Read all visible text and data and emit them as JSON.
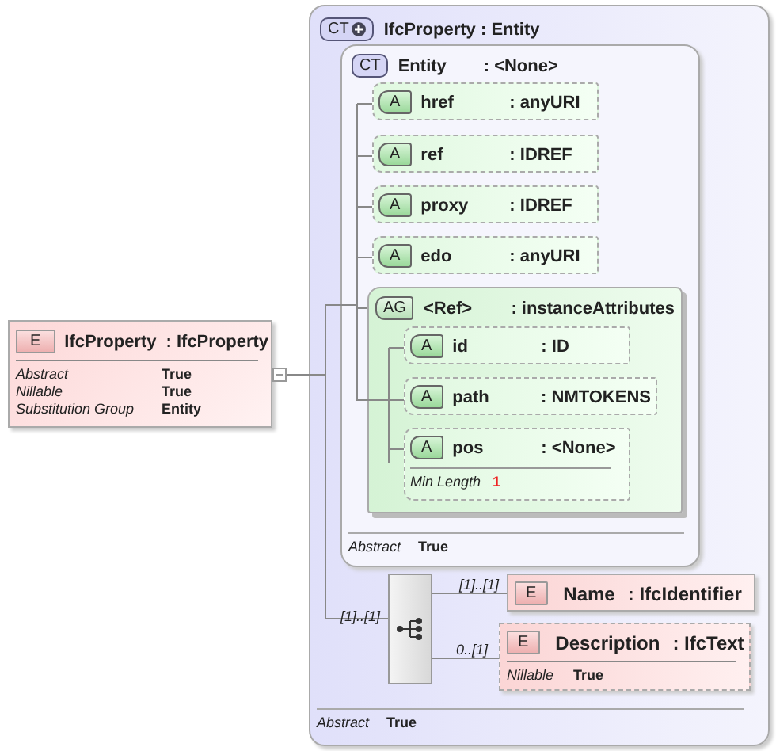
{
  "root_element": {
    "badge": "E",
    "name": "IfcProperty",
    "type": ": IfcProperty",
    "properties": [
      {
        "label": "Abstract",
        "value": "True"
      },
      {
        "label": "Nillable",
        "value": "True"
      },
      {
        "label": "Substitution Group",
        "value": "Entity"
      }
    ]
  },
  "complex_type": {
    "badge": "CT",
    "name": "IfcProperty : Entity",
    "base": {
      "badge": "CT",
      "name": "Entity",
      "type": ": <None>",
      "attributes": [
        {
          "badge": "A",
          "name": "href",
          "type": ": anyURI",
          "optional": true
        },
        {
          "badge": "A",
          "name": "ref",
          "type": ": IDREF",
          "optional": true
        },
        {
          "badge": "A",
          "name": "proxy",
          "type": ": IDREF",
          "optional": true
        },
        {
          "badge": "A",
          "name": "edo",
          "type": ": anyURI",
          "optional": true
        }
      ],
      "attribute_group": {
        "badge": "AG",
        "name": "<Ref>",
        "type": ": instanceAttributes",
        "attributes": [
          {
            "badge": "A",
            "name": "id",
            "type": ": ID",
            "optional": true
          },
          {
            "badge": "A",
            "name": "path",
            "type": ": NMTOKENS",
            "optional": true
          },
          {
            "badge": "A",
            "name": "pos",
            "type": ": <None>",
            "optional": true,
            "properties": [
              {
                "label": "Min Length",
                "value": "1"
              }
            ]
          }
        ]
      },
      "properties": [
        {
          "label": "Abstract",
          "value": "True"
        }
      ]
    },
    "sequence": {
      "occurrence": "[1]..[1]",
      "elements": [
        {
          "badge": "E",
          "name": "Name",
          "type": ": IfcIdentifier",
          "occurrence": "[1]..[1]",
          "optional": false
        },
        {
          "badge": "E",
          "name": "Description",
          "type": ": IfcText",
          "occurrence": "0..[1]",
          "optional": true,
          "properties": [
            {
              "label": "Nillable",
              "value": "True"
            }
          ]
        }
      ]
    },
    "properties": [
      {
        "label": "Abstract",
        "value": "True"
      }
    ]
  }
}
